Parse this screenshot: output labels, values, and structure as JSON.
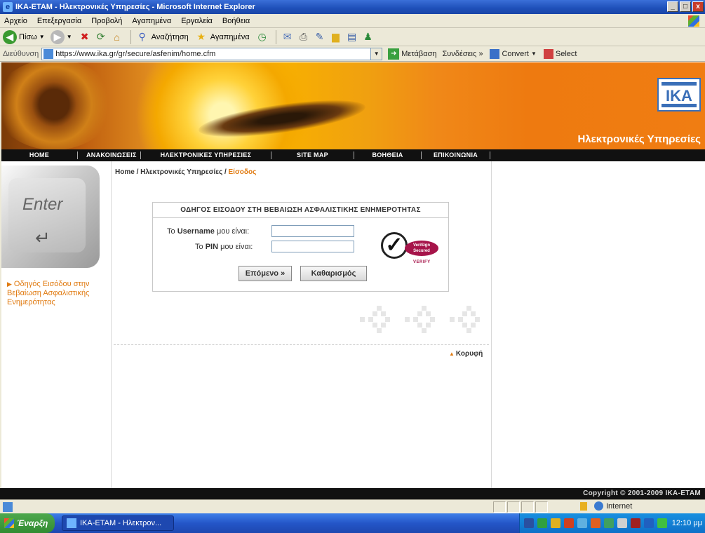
{
  "window": {
    "title": "ΙΚΑ-ΕΤΑΜ - Ηλεκτρονικές Υπηρεσίες - Microsoft Internet Explorer",
    "controls": [
      "_",
      "□",
      "x"
    ]
  },
  "menubar": [
    "Αρχείο",
    "Επεξεργασία",
    "Προβολή",
    "Αγαπημένα",
    "Εργαλεία",
    "Βοήθεια"
  ],
  "toolbar": {
    "back": "Πίσω",
    "search": "Αναζήτηση",
    "favorites": "Αγαπημένα"
  },
  "addressbar": {
    "label": "Διεύθυνση",
    "url": "https://www.ika.gr/gr/secure/asfenim/home.cfm",
    "go": "Μετάβαση",
    "links": "Συνδέσεις",
    "links_more": "»",
    "convert": "Convert",
    "select": "Select"
  },
  "banner": {
    "logo": "IKA",
    "tagline": "Ηλεκτρονικές Υπηρεσίες"
  },
  "nav": [
    "HOME",
    "ΑΝΑΚΟΙΝΩΣΕΙΣ",
    "ΗΛΕΚΤΡΟΝΙΚΕΣ ΥΠΗΡΕΣΙΕΣ",
    "SITE MAP",
    "ΒΟΗΘΕΙΑ",
    "ΕΠΙΚΟΙΝΩΝΙΑ"
  ],
  "sidebar": {
    "enter_key_label": "Enter",
    "link": "Οδηγός Εισόδου στην Βεβαίωση Ασφαλιστικής Ενημερότητας"
  },
  "breadcrumb": {
    "home": "Home",
    "sep1": " / ",
    "section": "Ηλεκτρονικές Υπηρεσίες",
    "sep2": " / ",
    "current": "Είσοδος"
  },
  "login": {
    "title": "ΟΔΗΓΟΣ ΕΙΣΟΔΟΥ ΣΤΗ ΒΕΒΑΙΩΣΗ ΑΣΦΑΛΙΣΤΙΚΗΣ ΕΝΗΜΕΡΟΤΗΤΑΣ",
    "username_prefix": "Το ",
    "username_bold": "Username",
    "username_suffix": " μου είναι:",
    "username_value": "",
    "pin_prefix": "Το ",
    "pin_bold": "PIN",
    "pin_suffix": " μου είναι:",
    "pin_value": "",
    "next_button": "Επόμενο »",
    "clear_button": "Καθαρισμός",
    "verisign_line1": "VeriSign",
    "verisign_line2": "Secured",
    "verisign_verify": "VERIFY"
  },
  "top_link": "Κορυφή",
  "footer": "Copyright © 2001-2009 IKA-ETAM",
  "statusbar": {
    "zone": "Internet"
  },
  "taskbar": {
    "start": "Έναρξη",
    "task": "ΙΚΑ-ΕΤΑΜ - Ηλεκτρον...",
    "clock": "12:10 μμ"
  }
}
